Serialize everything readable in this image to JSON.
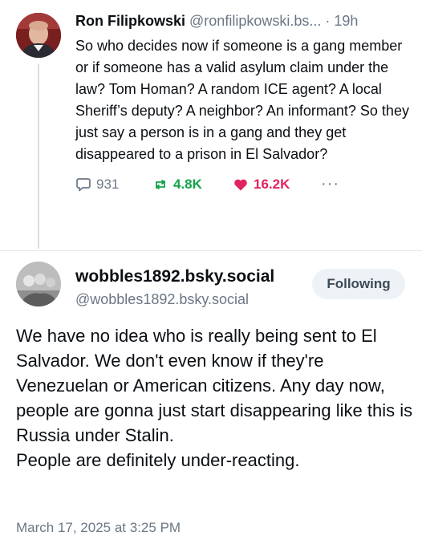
{
  "post1": {
    "author_name": "Ron Filipkowski",
    "handle": "@ronfilipkowski.bs...",
    "separator": "·",
    "time": "19h",
    "text": "So who decides now if someone is a gang member or if someone has a valid asylum claim under the law? Tom Homan? A random ICE agent? A local Sheriff’s deputy? A neighbor? An informant? So they just say a person is in a gang and they get disappeared to a prison in El Salvador?",
    "replies": "931",
    "reposts": "4.8K",
    "likes": "16.2K",
    "more": "···",
    "colors": {
      "repost": "#13a34a",
      "like": "#e0245e"
    }
  },
  "post2": {
    "author_name": "wobbles1892.bsky.social",
    "handle": "@wobbles1892.bsky.social",
    "follow_label": "Following",
    "paragraphs": [
      "We have no idea who is really being sent to El Salvador. We don't even know if they're Venezuelan or American citizens. Any day now, people are gonna just start disappearing like this is Russia under Stalin.",
      "People are definitely under-reacting."
    ],
    "date": "March 17, 2025 at 3:25 PM"
  }
}
